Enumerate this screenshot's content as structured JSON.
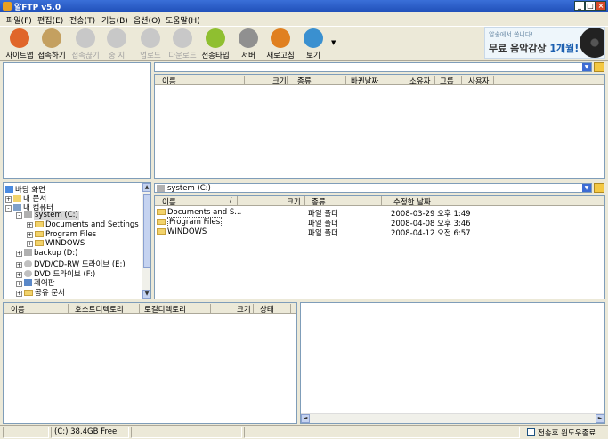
{
  "window": {
    "title": "알FTP v5.0"
  },
  "menu": [
    "파일(F)",
    "편집(E)",
    "전송(T)",
    "기능(B)",
    "옵션(O)",
    "도움말(H)"
  ],
  "toolbar": {
    "buttons": [
      {
        "label": "사이트맵",
        "icon": "site-map-icon",
        "enabled": true,
        "color": "#e0662a"
      },
      {
        "label": "접속하기",
        "icon": "connect-icon",
        "enabled": true,
        "color": "#c4a060"
      },
      {
        "label": "접속끊기",
        "icon": "disconnect-icon",
        "enabled": false,
        "color": "#cccccc"
      },
      {
        "label": "중 지",
        "icon": "stop-icon",
        "enabled": false,
        "color": "#cccccc"
      },
      {
        "label": "업로드",
        "icon": "upload-icon",
        "enabled": false,
        "color": "#cccccc"
      },
      {
        "label": "다운로드",
        "icon": "download-icon",
        "enabled": false,
        "color": "#cccccc"
      },
      {
        "label": "전송타입",
        "icon": "transfer-type-icon",
        "enabled": true,
        "color": "#8fbf30"
      },
      {
        "label": "서버",
        "icon": "server-icon",
        "enabled": true,
        "color": "#909090"
      },
      {
        "label": "새로고침",
        "icon": "refresh-icon",
        "enabled": true,
        "color": "#e08020"
      },
      {
        "label": "보기",
        "icon": "view-icon",
        "enabled": true,
        "color": "#3a90d0"
      }
    ]
  },
  "banner": {
    "line1": "알송에서 쏩니다!",
    "line2_a": "무료 음악감상 ",
    "line2_b": "1개월!"
  },
  "remote": {
    "columns": [
      "이름",
      "크기",
      "종류",
      "바뀐날짜",
      "소유자",
      "그룹",
      "사용자"
    ]
  },
  "local": {
    "path": "system (C:)",
    "columns": [
      "이름",
      "크기",
      "종류",
      "수정한 날짜"
    ],
    "rows": [
      {
        "name": "Documents and S...",
        "size": "",
        "type": "파일 폴더",
        "date": "2008-03-29 오후 1:49"
      },
      {
        "name": "Program Files",
        "size": "",
        "type": "파일 폴더",
        "date": "2008-04-08 오후 3:46"
      },
      {
        "name": "WINDOWS",
        "size": "",
        "type": "파일 폴더",
        "date": "2008-04-12 오전 6:57"
      }
    ]
  },
  "tree": [
    {
      "label": "바탕 화면",
      "indent": 0,
      "toggle": "",
      "icon": "desktop-icon"
    },
    {
      "label": "내 문서",
      "indent": 1,
      "toggle": "+",
      "icon": "documents-icon"
    },
    {
      "label": "내 컴퓨터",
      "indent": 1,
      "toggle": "-",
      "icon": "computer-icon"
    },
    {
      "label": "system (C:)",
      "indent": 2,
      "toggle": "-",
      "icon": "drive-icon"
    },
    {
      "label": "Documents and Settings",
      "indent": 3,
      "toggle": "+",
      "icon": "folder-icon"
    },
    {
      "label": "Program Files",
      "indent": 3,
      "toggle": "+",
      "icon": "folder-icon"
    },
    {
      "label": "WINDOWS",
      "indent": 3,
      "toggle": "+",
      "icon": "folder-icon"
    },
    {
      "label": "backup (D:)",
      "indent": 2,
      "toggle": "+",
      "icon": "drive-icon"
    },
    {
      "label": "DVD/CD-RW 드라이브 (E:)",
      "indent": 2,
      "toggle": "+",
      "icon": "cd-drive-icon"
    },
    {
      "label": "DVD 드라이브 (F:)",
      "indent": 2,
      "toggle": "+",
      "icon": "dvd-drive-icon"
    },
    {
      "label": "제어판",
      "indent": 2,
      "toggle": "+",
      "icon": "control-panel-icon"
    },
    {
      "label": "공유 문서",
      "indent": 2,
      "toggle": "+",
      "icon": "shared-folder-icon"
    }
  ],
  "queue": {
    "columns": [
      "이름",
      "호스트디렉토리",
      "로컬디렉토리",
      "크기",
      "상태"
    ]
  },
  "status": {
    "drive": "(C:)  38.4GB Free",
    "checkbox_label": "전송후 윈도우종료",
    "checkbox_checked": false
  }
}
